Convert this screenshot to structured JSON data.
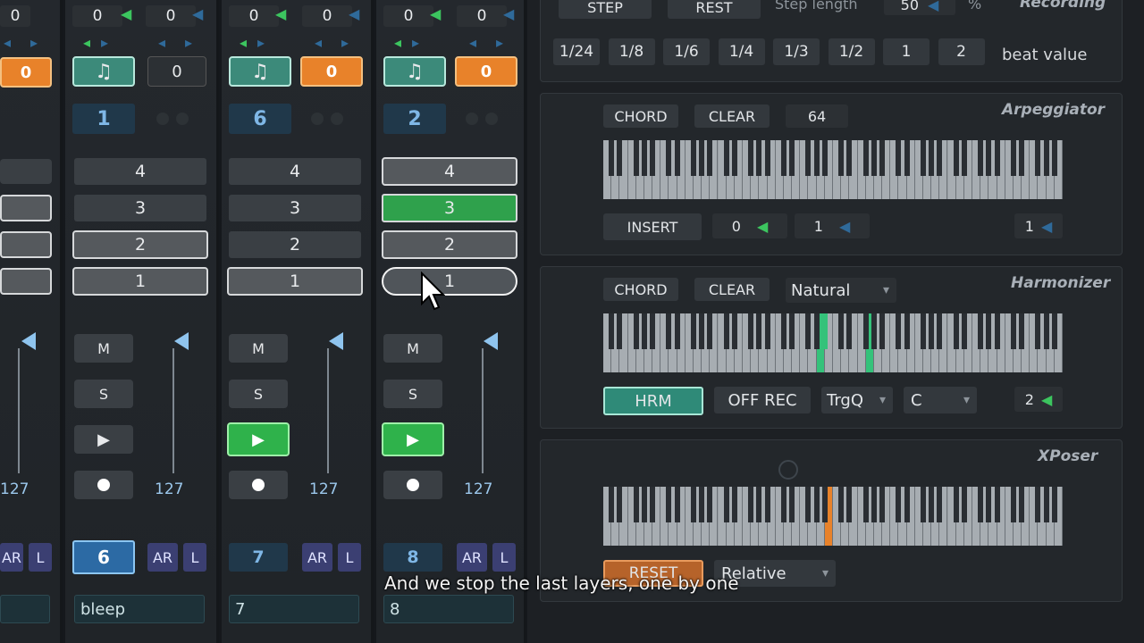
{
  "strips": [
    {
      "top_values": [
        "0"
      ],
      "orange_value": "0",
      "channel": "",
      "velocity": "127",
      "bottom_buttons": [
        "AR",
        "L"
      ],
      "layers": [
        "",
        "",
        "",
        ""
      ]
    },
    {
      "top_values": [
        "0",
        "0"
      ],
      "zero_button": "0",
      "channel": "1",
      "layers": [
        "4",
        "3",
        "2",
        "1"
      ],
      "mute": "M",
      "solo": "S",
      "velocity": "127",
      "number_button": "6",
      "bottom_buttons": [
        "AR",
        "L"
      ],
      "name": "bleep"
    },
    {
      "top_values": [
        "0",
        "0"
      ],
      "orange_value": "0",
      "channel": "6",
      "layers": [
        "4",
        "3",
        "2",
        "1"
      ],
      "mute": "M",
      "solo": "S",
      "velocity": "127",
      "number_button": "7",
      "bottom_buttons": [
        "AR",
        "L"
      ],
      "name": "7"
    },
    {
      "top_values": [
        "0",
        "0"
      ],
      "orange_value": "0",
      "channel": "2",
      "layers": [
        "4",
        "3",
        "2",
        "1"
      ],
      "mute": "M",
      "solo": "S",
      "velocity": "127",
      "number_button": "8",
      "bottom_buttons": [
        "AR",
        "L"
      ],
      "name": "8"
    }
  ],
  "recording": {
    "title": "Recording",
    "step_label": "STEP",
    "rest_label": "REST",
    "step_length_label": "Step length",
    "step_length_value": "50",
    "step_length_unit": "%",
    "beat_values": [
      "1/24",
      "1/8",
      "1/6",
      "1/4",
      "1/3",
      "1/2",
      "1",
      "2"
    ],
    "beat_value_label": "beat value"
  },
  "arpeggiator": {
    "title": "Arpeggiator",
    "chord": "CHORD",
    "clear": "CLEAR",
    "value": "64",
    "insert": "INSERT",
    "param1": "0",
    "param2": "1",
    "param3": "1"
  },
  "harmonizer": {
    "title": "Harmonizer",
    "chord": "CHORD",
    "clear": "CLEAR",
    "scale": "Natural",
    "hrm": "HRM",
    "off_rec": "OFF REC",
    "trigger": "TrgQ",
    "key": "C",
    "value": "2"
  },
  "xposer": {
    "title": "XPoser",
    "reset": "RESET",
    "mode": "Relative"
  },
  "caption": "And we stop the last layers, one by one",
  "colors": {
    "accent_green": "#2fa14c",
    "accent_orange": "#e8822a",
    "accent_teal": "#3c8a7a",
    "channel_blue": "#7fb7e6"
  }
}
